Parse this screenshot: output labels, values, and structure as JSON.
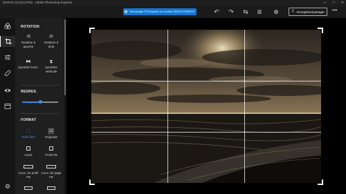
{
  "window": {
    "title": "2019-11-18 (21).PNG - Adobe Photoshop Express",
    "minimize_glyph": "—",
    "maximize_glyph": "□",
    "close_glyph": "✕"
  },
  "toolbar": {
    "promo_label": "Télécharger PS Express sur mobile GRATUITEMENT",
    "undo_glyph": "↶",
    "redo_glyph": "↷",
    "compare_glyph": "⇆",
    "zoom_glyph": "⊕",
    "save_label": "Enregistrer/partager",
    "more_glyph": "•••"
  },
  "sidebar": {
    "icons": [
      "effects-icon",
      "crop-icon",
      "adjust-icon",
      "healing-icon",
      "eye-icon",
      "frame-icon"
    ],
    "settings_glyph": "⚙"
  },
  "panel": {
    "rotation": {
      "heading": "ROTATION",
      "items": [
        {
          "label": "Rotation à gauche",
          "glyph": "⟲"
        },
        {
          "label": "Rotation à droit",
          "glyph": "⟳"
        },
        {
          "label": "Symétrie horiz.",
          "glyph": "⧓"
        },
        {
          "label": "Symétrie verticale",
          "glyph": "⧗"
        }
      ]
    },
    "straighten": {
      "heading": "REDRES.",
      "value": 0.5
    },
    "format": {
      "heading": "FORMAT",
      "items": [
        {
          "label": "Taille libre",
          "glyph": "⛶",
          "selected": true
        },
        {
          "label": "Originale",
          "glyph": "🖼",
          "selected": false
        },
        {
          "label": "Carré",
          "glyph": "",
          "selected": false
        },
        {
          "label": "Profil FB",
          "glyph": "",
          "selected": false
        },
        {
          "label": "Couv. de profil FB",
          "glyph": "",
          "selected": false
        },
        {
          "label": "Couv. de page FB",
          "glyph": "",
          "selected": false
        }
      ]
    }
  },
  "colors": {
    "accent": "#3b8eea",
    "promo": "#1478d4"
  }
}
